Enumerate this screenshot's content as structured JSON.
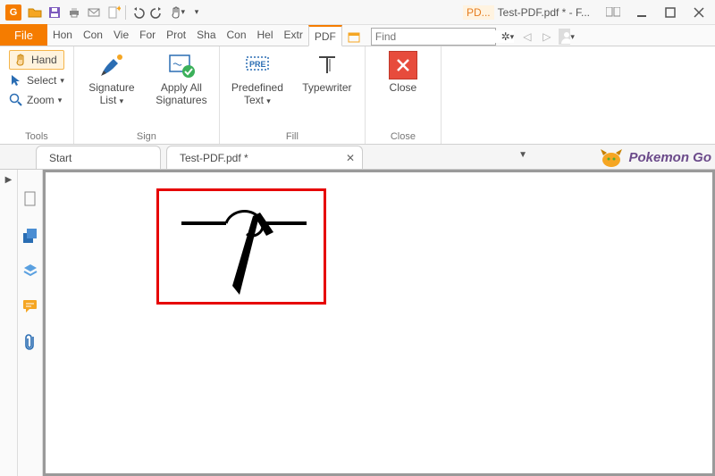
{
  "qat": {
    "corner_bg": "#f57c00"
  },
  "window": {
    "doc_badge": "PD...",
    "title": "Test-PDF.pdf * - F..."
  },
  "find": {
    "placeholder": "Find"
  },
  "tabs": {
    "file": "File",
    "items": [
      "Hon",
      "Con",
      "Vie",
      "For",
      "Prot",
      "Sha",
      "Con",
      "Hel",
      "Extr",
      "PDF"
    ]
  },
  "ribbon": {
    "tools": {
      "label": "Tools",
      "hand": "Hand",
      "select": "Select",
      "zoom": "Zoom"
    },
    "sign": {
      "label": "Sign",
      "signature_list": "Signature List",
      "apply_all": "Apply All Signatures"
    },
    "fill": {
      "label": "Fill",
      "predefined": "Predefined Text",
      "typewriter": "Typewriter"
    },
    "close": {
      "label": "Close",
      "btn": "Close"
    }
  },
  "doc_tabs": {
    "start": "Start",
    "fname": "Test-PDF.pdf *"
  },
  "promo": "Pokemon Go",
  "colors": {
    "accent": "#f57c00",
    "close_red": "#e74c3c",
    "annotation_red": "#e60000"
  }
}
